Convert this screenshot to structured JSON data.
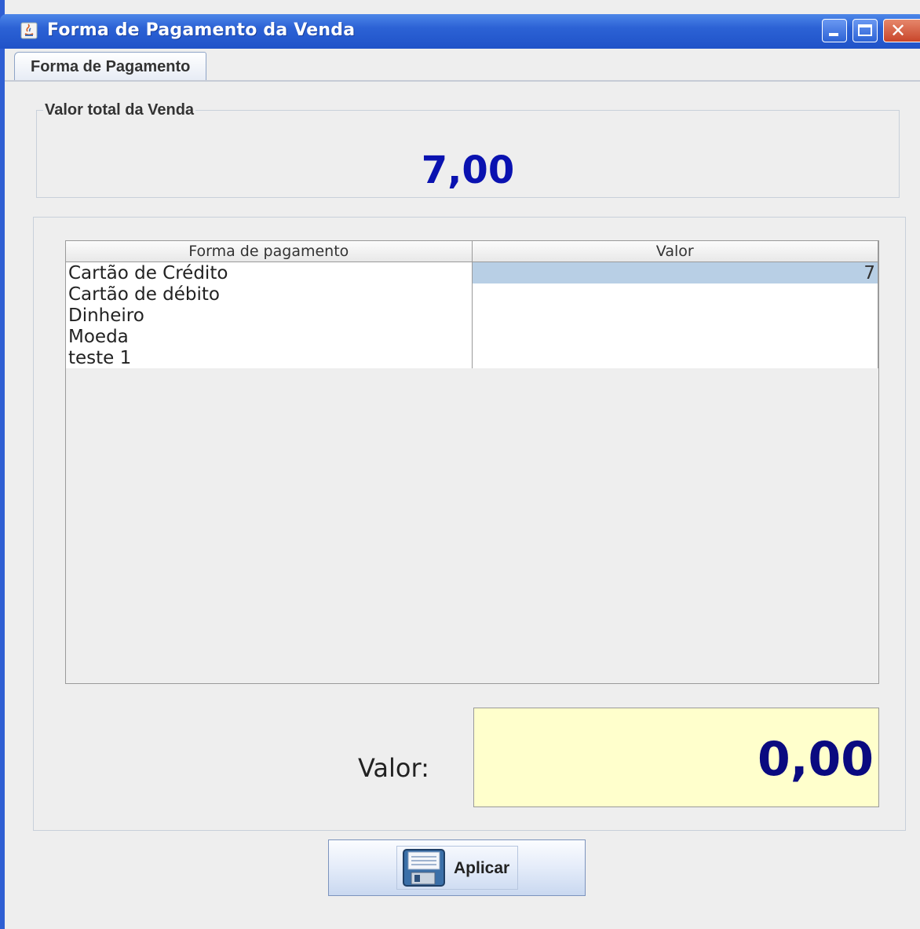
{
  "window": {
    "title": "Forma de Pagamento da Venda",
    "close_glyph": "✕"
  },
  "tabs": [
    {
      "label": "Forma de Pagamento",
      "selected": true
    }
  ],
  "total_group": {
    "legend": "Valor total da Venda",
    "value": "7,00",
    "value_color": "#0a12b0"
  },
  "table": {
    "columns": [
      "Forma de pagamento",
      "Valor"
    ],
    "rows": [
      {
        "method": "Cartão de Crédito",
        "value": "7",
        "selected_value": true
      },
      {
        "method": "Cartão de débito",
        "value": ""
      },
      {
        "method": "Dinheiro",
        "value": ""
      },
      {
        "method": "Moeda",
        "value": ""
      },
      {
        "method": "teste 1",
        "value": ""
      }
    ]
  },
  "valor": {
    "label": "Valor:",
    "amount": "0,00",
    "field_bg": "#ffffcc",
    "amount_color": "#0a0a80"
  },
  "apply_button": {
    "label": "Aplicar",
    "icon": "floppy-disk-icon"
  },
  "colors": {
    "titlebar": "#2c62d5",
    "selection": "#b8cfe5"
  }
}
